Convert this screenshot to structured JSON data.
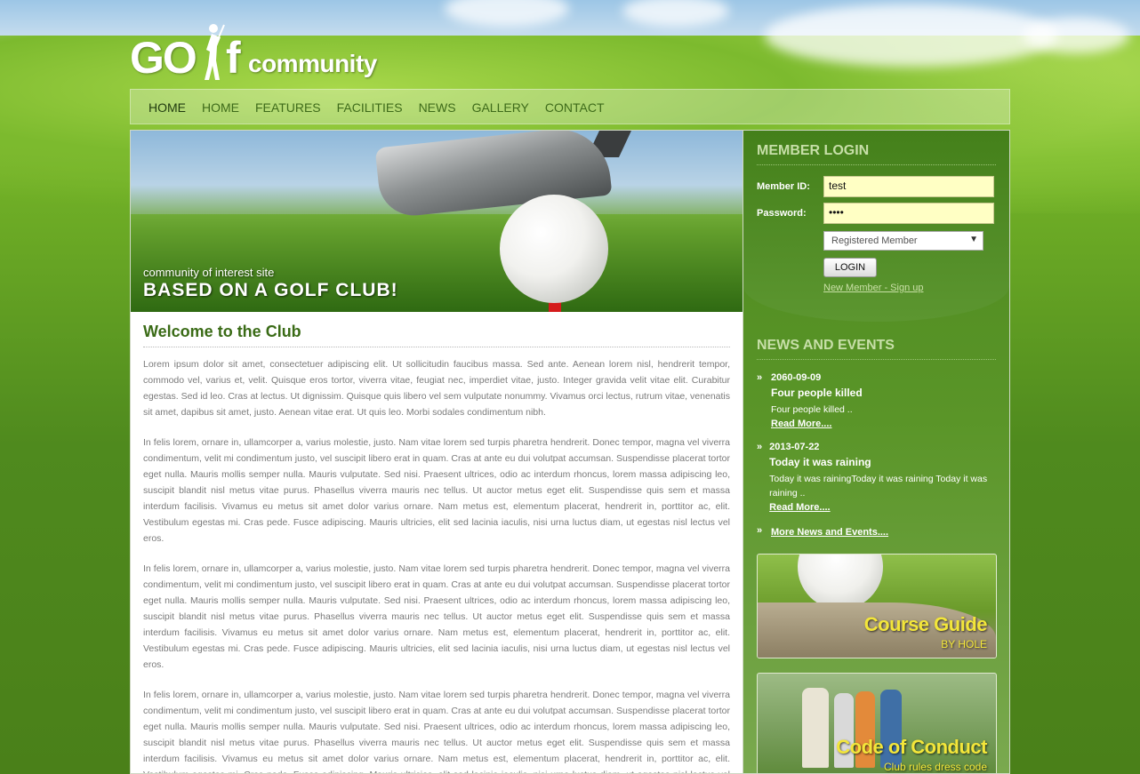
{
  "logo": {
    "part1": "GO",
    "part2": "f",
    "part3": "community"
  },
  "nav": {
    "items": [
      "HOME",
      "HOME",
      "FEATURES",
      "FACILITIES",
      "NEWS",
      "GALLERY",
      "CONTACT"
    ]
  },
  "banner": {
    "small": "community of interest site",
    "big": "BASED ON A GOLF CLUB!"
  },
  "main": {
    "heading": "Welcome to the Club",
    "paragraphs": [
      "Lorem ipsum dolor sit amet, consectetuer adipiscing elit. Ut sollicitudin faucibus massa. Sed ante. Aenean lorem nisl, hendrerit tempor, commodo vel, varius et, velit. Quisque eros tortor, viverra vitae, feugiat nec, imperdiet vitae, justo. Integer gravida velit vitae elit. Curabitur egestas. Sed id leo. Cras at lectus. Ut dignissim. Quisque quis libero vel sem vulputate nonummy. Vivamus orci lectus, rutrum vitae, venenatis sit amet, dapibus sit amet, justo. Aenean vitae erat. Ut quis leo. Morbi sodales condimentum nibh.",
      "In felis lorem, ornare in, ullamcorper a, varius molestie, justo. Nam vitae lorem sed turpis pharetra hendrerit. Donec tempor, magna vel viverra condimentum, velit mi condimentum justo, vel suscipit libero erat in quam. Cras at ante eu dui volutpat accumsan. Suspendisse placerat tortor eget nulla. Mauris mollis semper nulla. Mauris vulputate. Sed nisi. Praesent ultrices, odio ac interdum rhoncus, lorem massa adipiscing leo, suscipit blandit nisl metus vitae purus. Phasellus viverra mauris nec tellus. Ut auctor metus eget elit. Suspendisse quis sem et massa interdum facilisis. Vivamus eu metus sit amet dolor varius ornare. Nam metus est, elementum placerat, hendrerit in, porttitor ac, elit. Vestibulum egestas mi. Cras pede. Fusce adipiscing. Mauris ultricies, elit sed lacinia iaculis, nisi urna luctus diam, ut egestas nisl lectus vel eros.",
      "In felis lorem, ornare in, ullamcorper a, varius molestie, justo. Nam vitae lorem sed turpis pharetra hendrerit. Donec tempor, magna vel viverra condimentum, velit mi condimentum justo, vel suscipit libero erat in quam. Cras at ante eu dui volutpat accumsan. Suspendisse placerat tortor eget nulla. Mauris mollis semper nulla. Mauris vulputate. Sed nisi. Praesent ultrices, odio ac interdum rhoncus, lorem massa adipiscing leo, suscipit blandit nisl metus vitae purus. Phasellus viverra mauris nec tellus. Ut auctor metus eget elit. Suspendisse quis sem et massa interdum facilisis. Vivamus eu metus sit amet dolor varius ornare. Nam metus est, elementum placerat, hendrerit in, porttitor ac, elit. Vestibulum egestas mi. Cras pede. Fusce adipiscing. Mauris ultricies, elit sed lacinia iaculis, nisi urna luctus diam, ut egestas nisl lectus vel eros.",
      "In felis lorem, ornare in, ullamcorper a, varius molestie, justo. Nam vitae lorem sed turpis pharetra hendrerit. Donec tempor, magna vel viverra condimentum, velit mi condimentum justo, vel suscipit libero erat in quam. Cras at ante eu dui volutpat accumsan. Suspendisse placerat tortor eget nulla. Mauris mollis semper nulla. Mauris vulputate. Sed nisi. Praesent ultrices, odio ac interdum rhoncus, lorem massa adipiscing leo, suscipit blandit nisl metus vitae purus. Phasellus viverra mauris nec tellus. Ut auctor metus eget elit. Suspendisse quis sem et massa interdum facilisis. Vivamus eu metus sit amet dolor varius ornare. Nam metus est, elementum placerat, hendrerit in, porttitor ac, elit. Vestibulum egestas mi. Cras pede. Fusce adipiscing. Mauris ultricies, elit sed lacinia iaculis, nisi urna luctus diam, ut egestas nisl lectus vel eros."
    ]
  },
  "login": {
    "heading": "MEMBER LOGIN",
    "member_id_label": "Member ID:",
    "member_id_value": "test",
    "password_label": "Password:",
    "password_value": "••••",
    "select_value": "Registered Member",
    "button": "LOGIN",
    "signup": "New Member - Sign up"
  },
  "news": {
    "heading": "NEWS AND EVENTS",
    "items": [
      {
        "date": "2060-09-09",
        "title": "Four people killed",
        "body": "Four people killed ..",
        "more": "Read More...."
      },
      {
        "date": "2013-07-22",
        "title": "Today it was raining",
        "body": "Today it was rainingToday it was raining Today it was raining ..",
        "more": "Read More...."
      }
    ],
    "all_link": "More News and Events...."
  },
  "promos": {
    "course": {
      "title": "Course Guide",
      "sub": "BY HOLE"
    },
    "conduct": {
      "title": "Code of Conduct",
      "sub": "Club rules dress code"
    }
  },
  "icons": {
    "bullet": "double-chevron-icon",
    "dropdown": "chevron-down-icon",
    "golfer": "golfer-icon"
  },
  "colors": {
    "nav_text": "#3e6b1a",
    "heading_green": "#3a6b16",
    "sidebar_green": "#4d8a1f",
    "promo_yellow": "#f3e63a",
    "input_bg": "#ffffc4"
  }
}
